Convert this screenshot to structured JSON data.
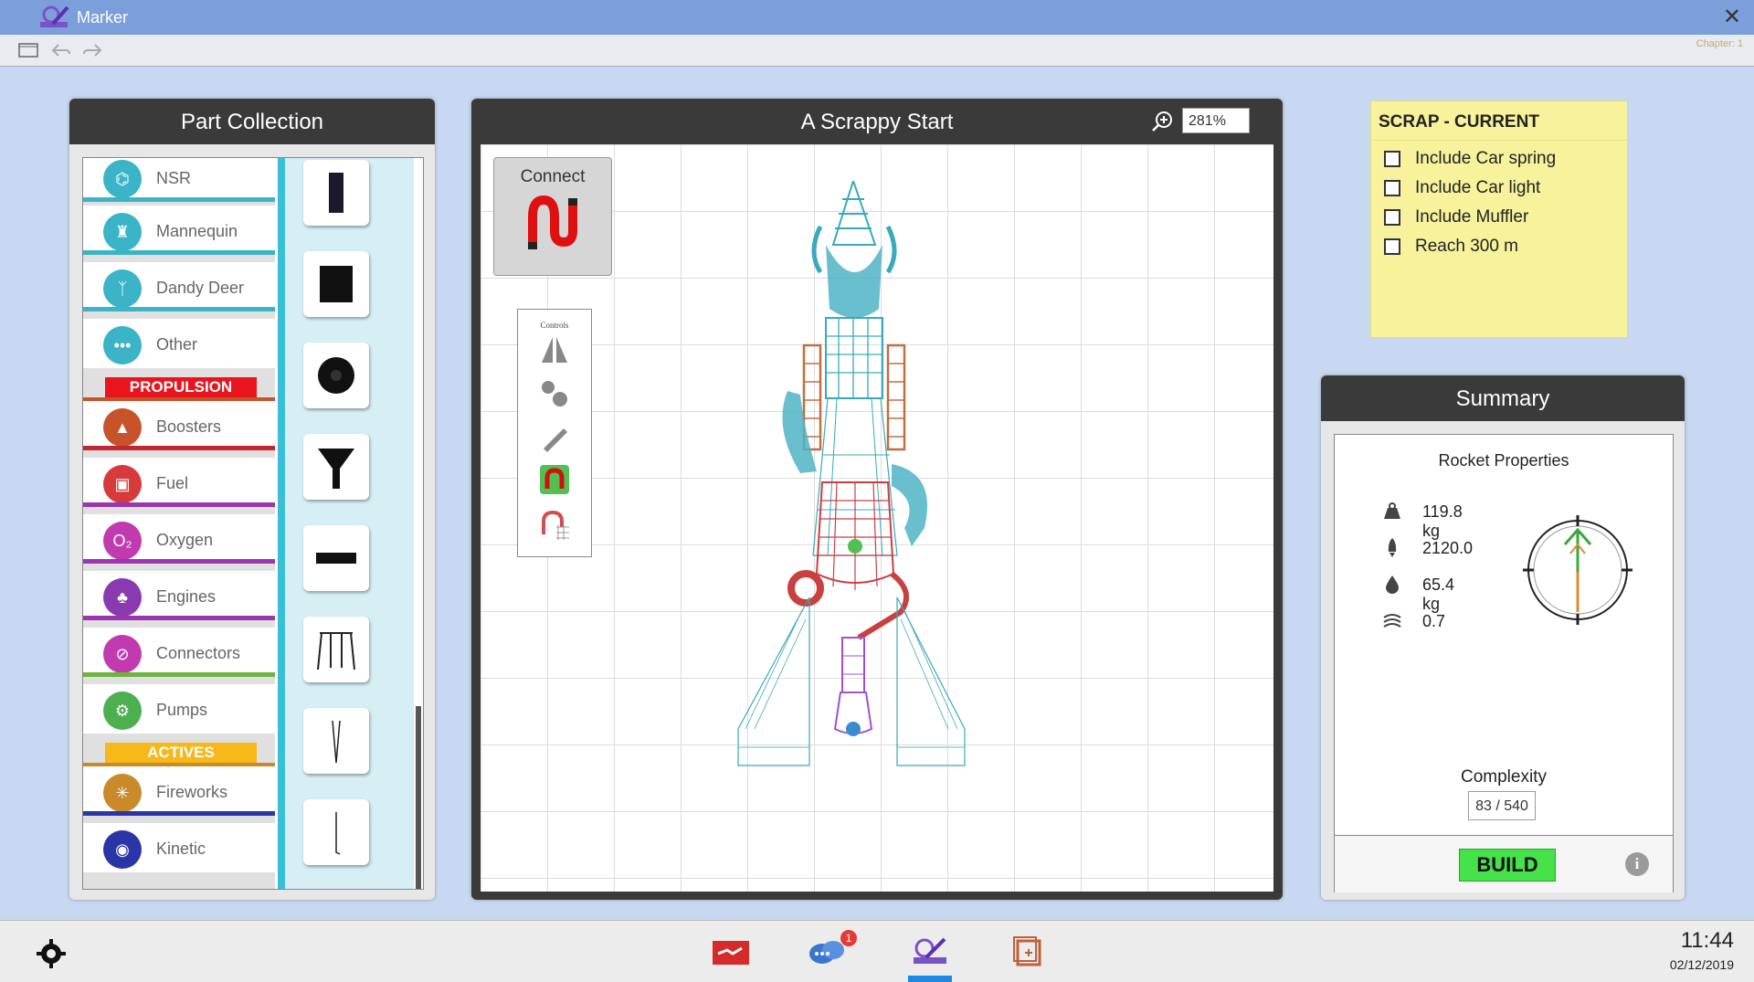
{
  "window": {
    "title": "Marker",
    "close_icon": "close-icon",
    "chapter": "Chapter: 1"
  },
  "part_collection": {
    "title": "Part Collection",
    "items_top": [
      {
        "label": "NSR",
        "icon": "nsr-icon",
        "color": "#3ab4c6",
        "bar": "#3ab4c6"
      },
      {
        "label": "Mannequin",
        "icon": "mannequin-icon",
        "color": "#3ab4c6",
        "bar": "#3ab4c6"
      },
      {
        "label": "Dandy Deer",
        "icon": "deer-icon",
        "color": "#3ab4c6",
        "bar": "#3ab4c6"
      },
      {
        "label": "Other",
        "icon": "more-icon",
        "color": "#3ab4c6",
        "bar": "#3ab4c6"
      }
    ],
    "propulsion_header": "PROPULSION",
    "items_propulsion": [
      {
        "label": "Boosters",
        "icon": "booster-icon",
        "color": "#c8522a",
        "bar": "#c8522a"
      },
      {
        "label": "Fuel",
        "icon": "fuel-icon",
        "color": "#d63a3a",
        "bar": "#c4262e"
      },
      {
        "label": "Oxygen",
        "icon": "oxygen-icon",
        "color": "#c23ab0",
        "bar": "#9b36b0"
      },
      {
        "label": "Engines",
        "icon": "engine-icon",
        "color": "#8a3ab0",
        "bar": "#9b36b0"
      },
      {
        "label": "Connectors",
        "icon": "connector-icon",
        "color": "#c23ab0",
        "bar": "#6db33f"
      },
      {
        "label": "Pumps",
        "icon": "pump-icon",
        "color": "#4caf50",
        "bar": "#6db33f"
      }
    ],
    "actives_header": "ACTIVES",
    "items_actives": [
      {
        "label": "Fireworks",
        "icon": "fireworks-icon",
        "color": "#c98a2a",
        "bar": "#2a35a8"
      },
      {
        "label": "Kinetic",
        "icon": "kinetic-icon",
        "color": "#2a35a8",
        "bar": "#2a35a8"
      }
    ]
  },
  "canvas": {
    "title": "A Scrappy Start",
    "zoom_value": "281%",
    "connect_label": "Connect",
    "controls_label": "Controls"
  },
  "scrap": {
    "title": "SCRAP   - CURRENT",
    "items": [
      "Include Car spring",
      "Include Car light",
      "Include Muffler",
      "Reach 300 m"
    ]
  },
  "summary": {
    "title": "Summary",
    "rocket_properties": "Rocket Properties",
    "mass": "119.8 kg",
    "thrust": "2120.0",
    "fuel": "65.4 kg",
    "drag": "0.7",
    "complexity_label": "Complexity",
    "complexity_value": "83 / 540",
    "build_label": "BUILD",
    "info_label": "i"
  },
  "taskbar": {
    "time": "11:44",
    "date": "02/12/2019",
    "chat_badge": "1"
  }
}
